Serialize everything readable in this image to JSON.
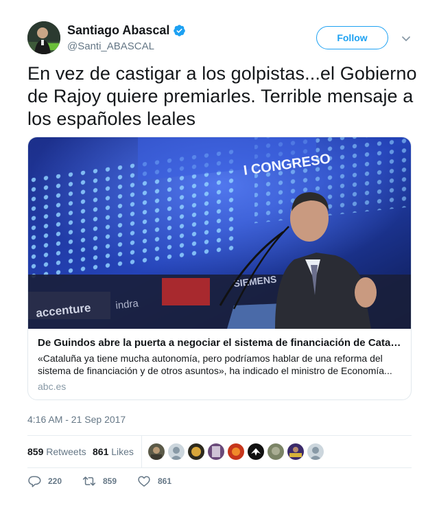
{
  "author": {
    "display_name": "Santiago Abascal",
    "handle": "@Santi_ABASCAL",
    "verified": true,
    "avatar_icon": "profile-photo"
  },
  "follow_label": "Follow",
  "tweet_text": "En vez de castigar a los golpistas...el Gobierno de Rajoy quiere premiarles. Terrible mensaje a los españoles leales",
  "card": {
    "image_sign_text": "I CONGRESO",
    "sponsor_texts": [
      "accenture",
      "indra",
      "SIEMENS"
    ],
    "title": "De Guindos abre la puerta a negociar el sistema de financiación de Cataluña …",
    "description": "«Cataluña ya tiene mucha autonomía, pero podríamos hablar de una reforma del sistema de financiación y de otros asuntos», ha indicado el ministro de Economía...",
    "domain": "abc.es"
  },
  "timestamp": "4:16 AM - 21 Sep 2017",
  "stats": {
    "retweets_count": "859",
    "retweets_label": "Retweets",
    "likes_count": "861",
    "likes_label": "Likes"
  },
  "actions": {
    "replies": "220",
    "retweets": "859",
    "likes": "861"
  },
  "colors": {
    "accent": "#1da1f2",
    "text_primary": "#14171a",
    "text_secondary": "#657786",
    "border": "#e1e8ed"
  }
}
